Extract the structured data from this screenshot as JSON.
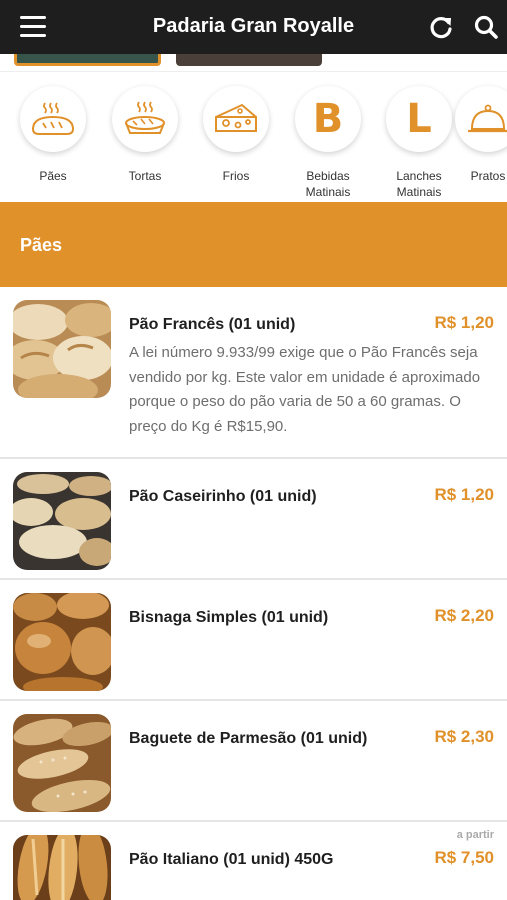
{
  "header": {
    "title": "Padaria Gran Royalle",
    "menu_icon": "hamburger-menu-icon",
    "refresh_icon": "refresh-icon",
    "search_icon": "search-icon",
    "background": "#1e1e1e"
  },
  "theme": {
    "accent": "#e0912a"
  },
  "categories": [
    {
      "label": "Pães",
      "icon": "bread-icon"
    },
    {
      "label": "Tortas",
      "icon": "pie-icon"
    },
    {
      "label": "Frios",
      "icon": "cheese-icon"
    },
    {
      "label": "Bebidas Matinais",
      "letter": "B"
    },
    {
      "label": "Lanches Matinais",
      "letter": "L"
    },
    {
      "label": "Pratos",
      "icon": "cloche-icon"
    }
  ],
  "section": {
    "title": "Pães"
  },
  "products": [
    {
      "name": "Pão Francês (01 unid)",
      "price": "R$ 1,20",
      "description": "A lei número 9.933/99 exige que o Pão Francês seja vendido por kg. Este valor em unidade é aproximado porque o peso do pão varia de 50 a 60 gramas. O preço do Kg é R$15,90."
    },
    {
      "name": "Pão Caseirinho (01 unid)",
      "price": "R$ 1,20"
    },
    {
      "name": "Bisnaga Simples (01 unid)",
      "price": "R$ 2,20"
    },
    {
      "name": "Baguete de Parmesão (01 unid)",
      "price": "R$ 2,30"
    },
    {
      "name": "Pão Italiano (01 unid) 450G",
      "price": "R$ 7,50",
      "price_prefix": "a partir"
    }
  ]
}
